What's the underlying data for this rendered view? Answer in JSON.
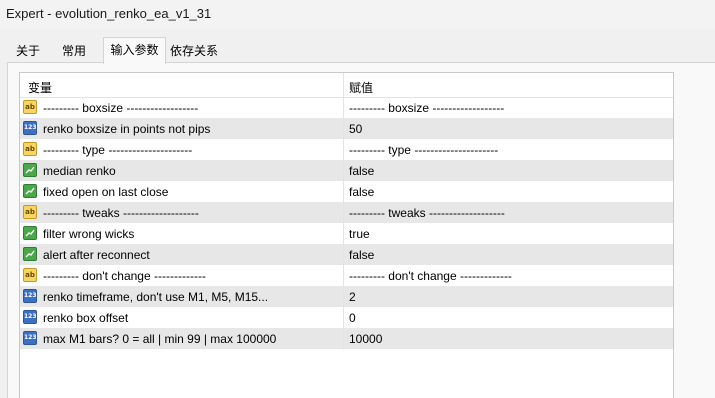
{
  "window": {
    "title": "Expert - evolution_renko_ea_v1_31"
  },
  "tabs": [
    {
      "label": "关于"
    },
    {
      "label": "常用"
    },
    {
      "label": "输入参数"
    },
    {
      "label": "依存关系"
    }
  ],
  "grid": {
    "columns": {
      "variable": "变量",
      "value": "赋值"
    },
    "rows": [
      {
        "type": "ab",
        "icon": "string-icon",
        "variable": "--------- boxsize ------------------",
        "value": "--------- boxsize ------------------"
      },
      {
        "type": "num",
        "icon": "integer-icon",
        "variable": "renko boxsize in points not pips",
        "value": "50"
      },
      {
        "type": "ab",
        "icon": "string-icon",
        "variable": "--------- type ---------------------",
        "value": "--------- type ---------------------"
      },
      {
        "type": "bool",
        "icon": "boolean-icon",
        "variable": "median renko",
        "value": "false"
      },
      {
        "type": "bool",
        "icon": "boolean-icon",
        "variable": "fixed open on last close",
        "value": "false"
      },
      {
        "type": "ab",
        "icon": "string-icon",
        "variable": "--------- tweaks -------------------",
        "value": "--------- tweaks -------------------"
      },
      {
        "type": "bool",
        "icon": "boolean-icon",
        "variable": "filter wrong wicks",
        "value": "true"
      },
      {
        "type": "bool",
        "icon": "boolean-icon",
        "variable": "alert after reconnect",
        "value": "false"
      },
      {
        "type": "ab",
        "icon": "string-icon",
        "variable": "--------- don't change -------------",
        "value": "--------- don't change -------------"
      },
      {
        "type": "num",
        "icon": "integer-icon",
        "variable": "renko timeframe, don't use M1, M5, M15...",
        "value": "2"
      },
      {
        "type": "num",
        "icon": "integer-icon",
        "variable": "renko box offset",
        "value": "0"
      },
      {
        "type": "num",
        "icon": "integer-icon",
        "variable": "max M1 bars? 0 = all | min 99 | max 100000",
        "value": "10000"
      }
    ]
  }
}
